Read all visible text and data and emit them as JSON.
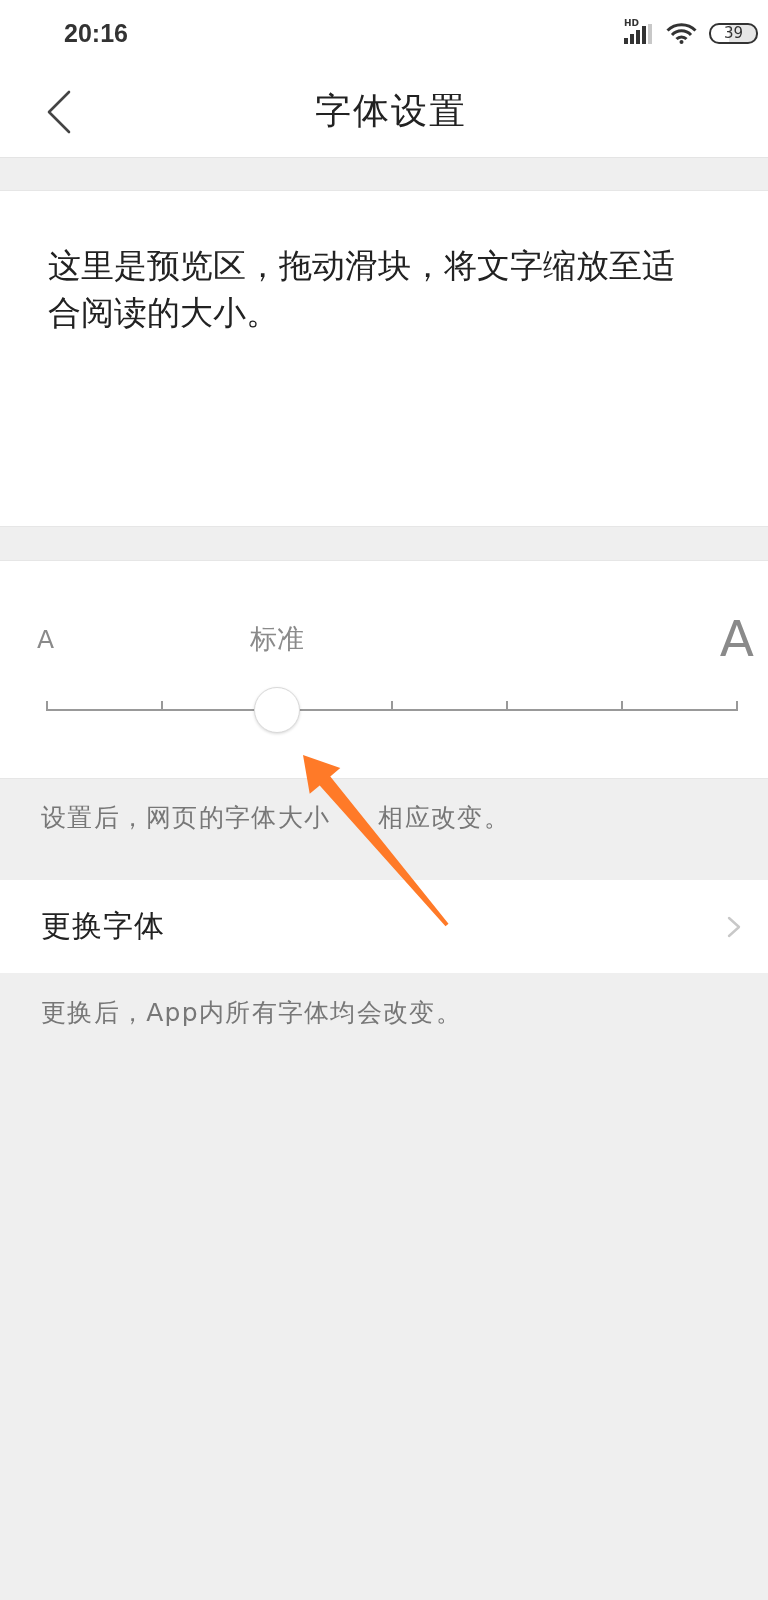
{
  "status_bar": {
    "time": "20:16",
    "network": "HD",
    "battery": "39"
  },
  "header": {
    "title": "字体设置"
  },
  "preview": {
    "text": "这里是预览区，拖动滑块，将文字缩放至适合阅读的大小。"
  },
  "font_size": {
    "small_label": "A",
    "current_label": "标准",
    "large_label": "A",
    "level": 0.3333
  },
  "size_note_parts": [
    "设置后，网页的字体大小",
    "相应改变。"
  ],
  "change_font": {
    "label": "更换字体"
  },
  "change_font_note": "更换后，App内所有字体均会改变。",
  "annotations": [
    {
      "kind": "arrow"
    }
  ]
}
